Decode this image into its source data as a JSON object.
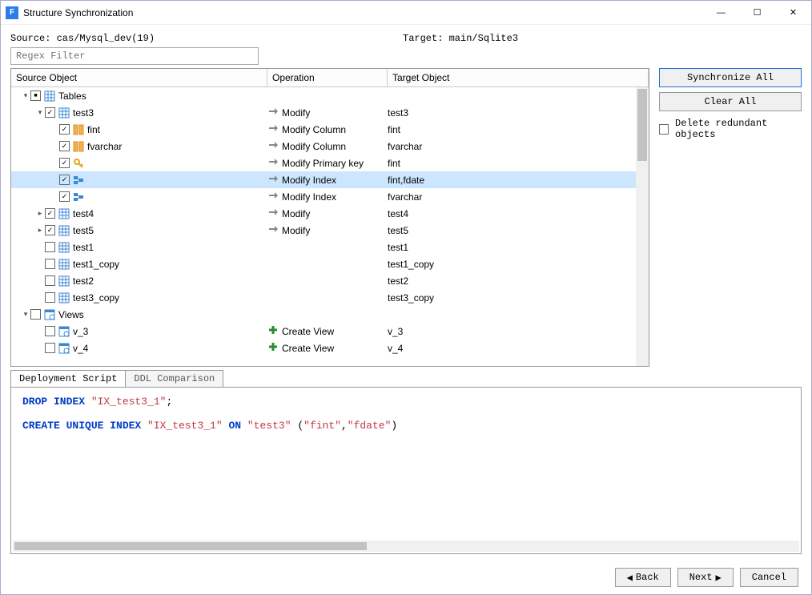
{
  "window": {
    "title": "Structure Synchronization"
  },
  "source_label": "Source: cas/Mysql_dev(19)",
  "target_label": "Target: main/Sqlite3",
  "filter_placeholder": "Regex Filter",
  "columns": {
    "src": "Source Object",
    "op": "Operation",
    "tgt": "Target Object"
  },
  "rows": [
    {
      "level": 0,
      "expand": "down",
      "check": "mixed",
      "icon": "tables",
      "label": "Tables",
      "op_icon": "",
      "op": "",
      "tgt": "",
      "selected": false
    },
    {
      "level": 1,
      "expand": "down",
      "check": "checked",
      "icon": "table",
      "label": "test3",
      "op_icon": "arrow",
      "op": "Modify",
      "tgt": "test3",
      "selected": false
    },
    {
      "level": 2,
      "expand": "",
      "check": "checked",
      "icon": "column",
      "label": "fint",
      "op_icon": "arrow",
      "op": "Modify Column",
      "tgt": "fint",
      "selected": false
    },
    {
      "level": 2,
      "expand": "",
      "check": "checked",
      "icon": "column",
      "label": "fvarchar",
      "op_icon": "arrow",
      "op": "Modify Column",
      "tgt": "fvarchar",
      "selected": false
    },
    {
      "level": 2,
      "expand": "",
      "check": "checked",
      "icon": "key",
      "label": "",
      "op_icon": "arrow",
      "op": "Modify Primary key",
      "tgt": "fint",
      "selected": false
    },
    {
      "level": 2,
      "expand": "",
      "check": "checked",
      "icon": "index",
      "label": "",
      "op_icon": "arrow",
      "op": "Modify Index",
      "tgt": "fint,fdate",
      "selected": true
    },
    {
      "level": 2,
      "expand": "",
      "check": "checked",
      "icon": "index",
      "label": "",
      "op_icon": "arrow",
      "op": "Modify Index",
      "tgt": "fvarchar",
      "selected": false
    },
    {
      "level": 1,
      "expand": "right",
      "check": "checked",
      "icon": "table",
      "label": "test4",
      "op_icon": "arrow",
      "op": "Modify",
      "tgt": "test4",
      "selected": false
    },
    {
      "level": 1,
      "expand": "right",
      "check": "checked",
      "icon": "table",
      "label": "test5",
      "op_icon": "arrow",
      "op": "Modify",
      "tgt": "test5",
      "selected": false
    },
    {
      "level": 1,
      "expand": "",
      "check": "",
      "icon": "table",
      "label": "test1",
      "op_icon": "",
      "op": "",
      "tgt": "test1",
      "selected": false
    },
    {
      "level": 1,
      "expand": "",
      "check": "",
      "icon": "table",
      "label": "test1_copy",
      "op_icon": "",
      "op": "",
      "tgt": "test1_copy",
      "selected": false
    },
    {
      "level": 1,
      "expand": "",
      "check": "",
      "icon": "table",
      "label": "test2",
      "op_icon": "",
      "op": "",
      "tgt": "test2",
      "selected": false
    },
    {
      "level": 1,
      "expand": "",
      "check": "",
      "icon": "table",
      "label": "test3_copy",
      "op_icon": "",
      "op": "",
      "tgt": "test3_copy",
      "selected": false
    },
    {
      "level": 0,
      "expand": "down",
      "check": "",
      "icon": "views",
      "label": "Views",
      "op_icon": "",
      "op": "",
      "tgt": "",
      "selected": false
    },
    {
      "level": 1,
      "expand": "",
      "check": "",
      "icon": "view",
      "label": "v_3",
      "op_icon": "plus",
      "op": "Create View",
      "tgt": "v_3",
      "selected": false
    },
    {
      "level": 1,
      "expand": "",
      "check": "",
      "icon": "view",
      "label": "v_4",
      "op_icon": "plus",
      "op": "Create View",
      "tgt": "v_4",
      "selected": false
    }
  ],
  "side": {
    "sync_all": "Synchronize All",
    "clear_all": "Clear All",
    "delete_redundant": "Delete redundant objects"
  },
  "tabs": {
    "deploy": "Deployment Script",
    "ddl": "DDL Comparison"
  },
  "script": {
    "line1_kw": "DROP INDEX",
    "line1_str": "\"IX_test3_1\"",
    "line1_end": ";",
    "line2_kw1": "CREATE UNIQUE INDEX",
    "line2_str1": "\"IX_test3_1\"",
    "line2_kw2": "ON",
    "line2_str2": "\"test3\"",
    "line2_paren_open": "(",
    "line2_str3": "\"fint\"",
    "line2_comma": ",",
    "line2_str4": "\"fdate\"",
    "line2_paren_close": ")"
  },
  "footer": {
    "back": "Back",
    "next": "Next",
    "cancel": "Cancel"
  }
}
